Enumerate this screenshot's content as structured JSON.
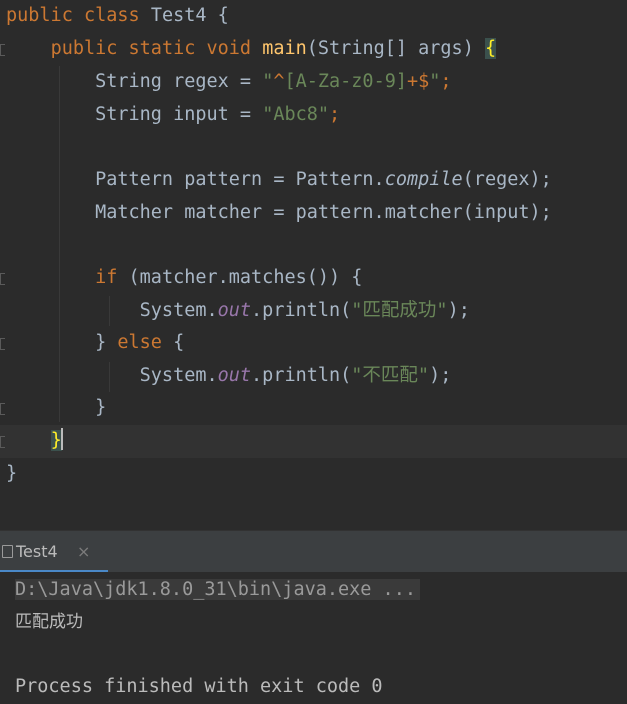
{
  "editor": {
    "line1": {
      "kw_public": "public",
      "kw_class": "class",
      "class_name": "Test4",
      "open_brace": "{"
    },
    "line2": {
      "kw_public": "public",
      "kw_static": "static",
      "kw_void": "void",
      "method": "main",
      "params": "(String[] args)",
      "brace": "{"
    },
    "line3": {
      "decl": "String regex = ",
      "q1": "\"",
      "caret_sym": "^",
      "cls": "[A-Za-z0-9]",
      "plus": "+",
      "dollar": "$",
      "q2": "\"",
      "semi": ";"
    },
    "line4": {
      "decl": "String input = ",
      "literal": "\"Abc8\"",
      "semi": ";"
    },
    "line5": {
      "pre": "Pattern pattern = Pattern.",
      "call": "compile",
      "post": "(regex);"
    },
    "line6": {
      "text": "Matcher matcher = pattern.matcher(input);"
    },
    "line7": {
      "kw_if": "if",
      "rest": " (matcher.matches()) {"
    },
    "line8": {
      "pre": "System.",
      "field": "out",
      "mid": ".println(",
      "literal": "\"匹配成功\"",
      "post": ");"
    },
    "line9": {
      "close": "} ",
      "kw_else": "else",
      "rest": " {"
    },
    "line10": {
      "pre": "System.",
      "field": "out",
      "mid": ".println(",
      "literal": "\"不匹配\"",
      "post": ");"
    },
    "line11": {
      "close": "}"
    },
    "line12": {
      "close": "}"
    },
    "line13": {
      "close": "}"
    }
  },
  "run_panel": {
    "tab_label": "Test4",
    "tab_close": "×",
    "command": "D:\\Java\\jdk1.8.0_31\\bin\\java.exe ...",
    "output": "匹配成功",
    "exit_message": "Process finished with exit code 0"
  },
  "colors": {
    "background": "#2b2b2b",
    "keyword": "#cc7832",
    "string": "#6a8759",
    "method": "#ffc66d",
    "field": "#9876aa",
    "text": "#a9b7c6"
  }
}
